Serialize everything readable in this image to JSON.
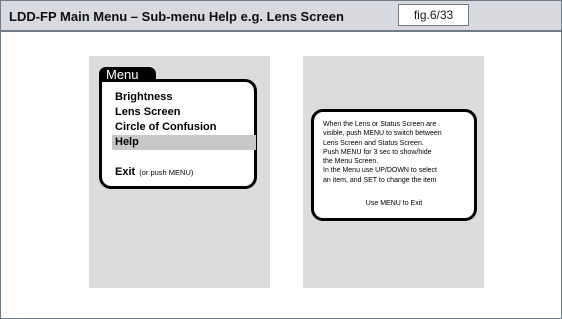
{
  "header": {
    "title": "LDD-FP Main Menu – Sub-menu Help e.g. Lens Screen",
    "figure_ref": "fig.6/33"
  },
  "menu_screen": {
    "tab_label": "Menu",
    "items": [
      {
        "label": "Brightness",
        "selected": false
      },
      {
        "label": "Lens Screen",
        "selected": false
      },
      {
        "label": "Circle of Confusion",
        "selected": false
      },
      {
        "label": "Help",
        "selected": true
      }
    ],
    "exit_label": "Exit",
    "exit_hint": "(or push MENU)"
  },
  "help_screen": {
    "lines": [
      "When the Lens or Status Screen are",
      "visible, push MENU to switch between",
      "Lens Screen and Status Screen.",
      "Push MENU for 3 sec to show/hide",
      "the Menu Screen.",
      "In the Menu use UP/DOWN to select",
      "an item, and SET to change the item"
    ],
    "exit_text": "Use MENU to Exit"
  }
}
